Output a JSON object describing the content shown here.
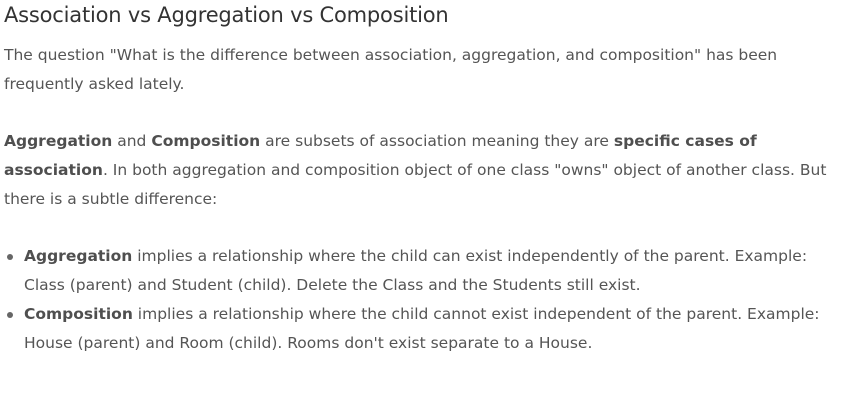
{
  "title": "Association vs Aggregation vs Composition",
  "intro": "The question \"What is the difference between association, aggregation, and composition\" has been frequently asked lately.",
  "subsets": {
    "term1": "Aggregation",
    "and": " and ",
    "term2": "Composition",
    "middle": " are subsets of association meaning they are ",
    "emphasis": "specific cases of association",
    "rest": ". In both aggregation and composition object of one class \"owns\" object of another class. But there is a subtle difference:"
  },
  "list": [
    {
      "term": "Aggregation",
      "text": " implies a relationship where the child can exist independently of the parent. Example: Class (parent) and Student (child). Delete the Class and the Students still exist."
    },
    {
      "term": "Composition",
      "text": " implies a relationship where the child cannot exist independent of the parent. Example: House (parent) and Room (child). Rooms don't exist separate to a House."
    }
  ]
}
